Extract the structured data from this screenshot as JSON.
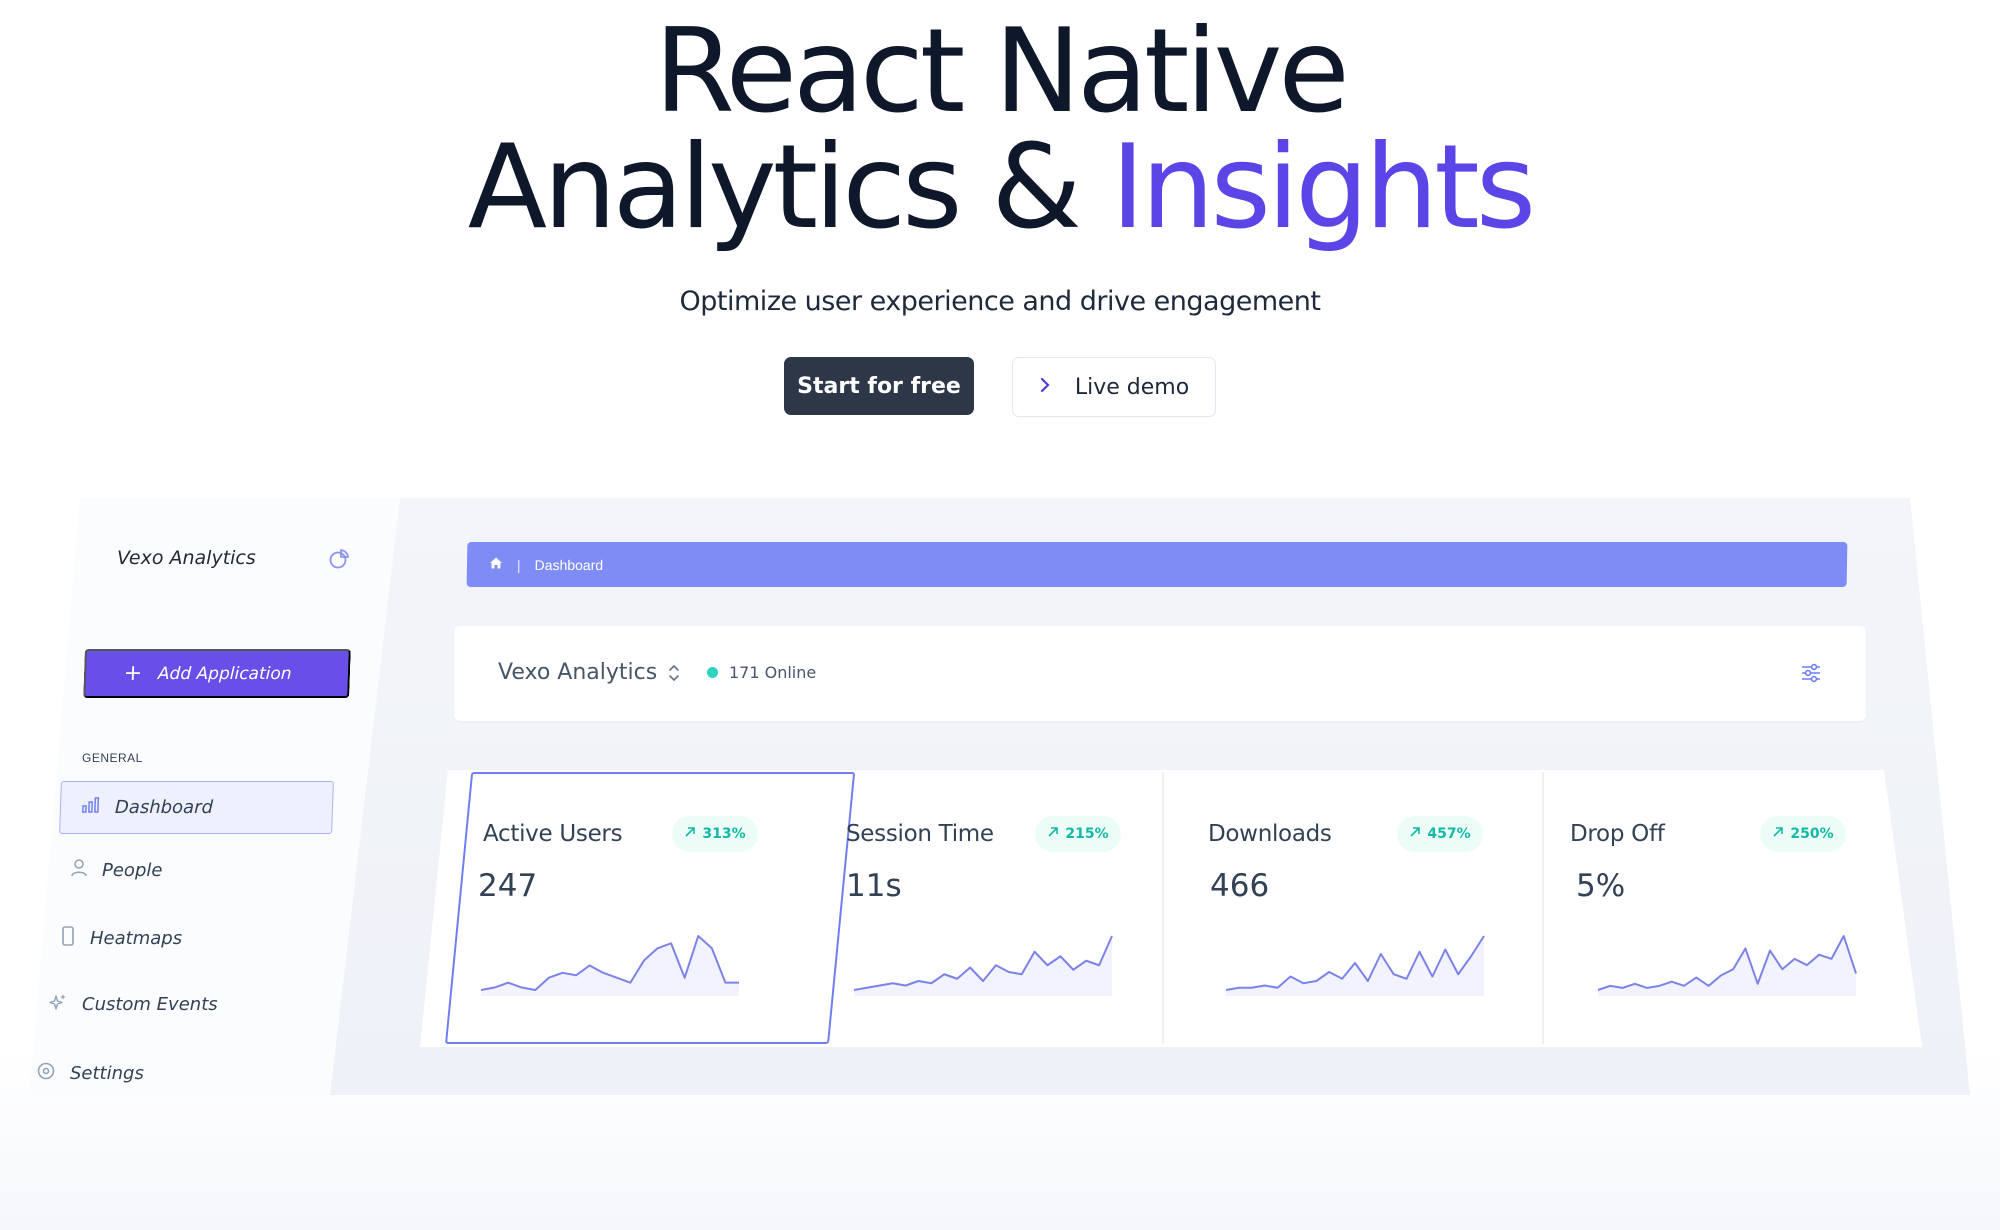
{
  "hero": {
    "title_line1": "React Native",
    "title_line2_prefix": "Analytics & ",
    "title_line2_accent": "Insights",
    "subtitle": "Optimize user experience and drive engagement",
    "primary_cta": "Start for free",
    "secondary_cta": "Live demo"
  },
  "colors": {
    "accent": "#5b45e6",
    "primary_button": "#2d3748",
    "breadcrumb_bar": "#7f8cf5",
    "add_button": "#6a4ee8",
    "positive": "#14b8a6",
    "online": "#2dd4bf"
  },
  "sidebar": {
    "brand": "Vexo Analytics",
    "add_button_label": "Add Application",
    "section_label": "GENERAL",
    "items": [
      {
        "label": "Dashboard",
        "icon": "bar-chart-icon",
        "active": true
      },
      {
        "label": "People",
        "icon": "user-icon"
      },
      {
        "label": "Heatmaps",
        "icon": "phone-icon"
      },
      {
        "label": "Custom Events",
        "icon": "sparkles-icon"
      },
      {
        "label": "Settings",
        "icon": "gear-icon"
      }
    ]
  },
  "breadcrumb": {
    "icon": "home-icon",
    "separator": "|",
    "current": "Dashboard"
  },
  "app_bar": {
    "app_name": "Vexo Analytics",
    "online": "171 Online",
    "filter_icon": "sliders-icon"
  },
  "stats": [
    {
      "label": "Active Users",
      "value": "247",
      "change": "313%",
      "trend": [
        3,
        4,
        6,
        4,
        3,
        8,
        10,
        9,
        13,
        10,
        8,
        6,
        15,
        20,
        22,
        8,
        25,
        20,
        6,
        6
      ]
    },
    {
      "label": "Session Time",
      "value": "11s",
      "change": "215%",
      "trend": [
        2,
        3,
        4,
        5,
        4,
        6,
        5,
        9,
        7,
        12,
        6,
        13,
        10,
        9,
        19,
        13,
        17,
        11,
        15,
        13,
        26
      ]
    },
    {
      "label": "Downloads",
      "value": "466",
      "change": "457%",
      "trend": [
        2,
        3,
        3,
        4,
        3,
        8,
        5,
        6,
        10,
        7,
        14,
        6,
        18,
        9,
        7,
        19,
        8,
        20,
        9,
        17,
        26
      ]
    },
    {
      "label": "Drop Off",
      "value": "5%",
      "change": "250%",
      "trend": [
        2,
        4,
        3,
        5,
        3,
        4,
        6,
        4,
        8,
        4,
        9,
        12,
        22,
        5,
        21,
        12,
        17,
        14,
        19,
        17,
        28,
        10
      ]
    }
  ]
}
